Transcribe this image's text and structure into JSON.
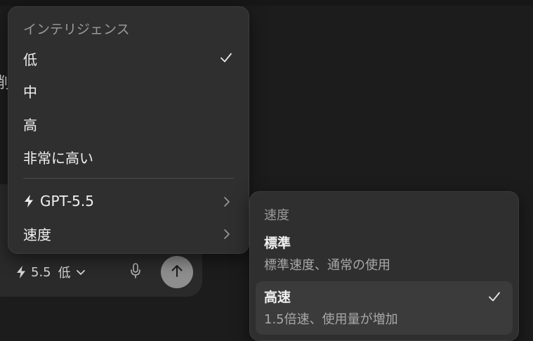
{
  "background": {
    "partial_text": "削"
  },
  "composer": {
    "model_short": "5.5",
    "level": "低",
    "icons": {
      "model": "bolt-icon",
      "dropdown": "chevron-down-icon",
      "mic": "microphone-icon",
      "send": "arrow-up-icon"
    },
    "send_button_color": "#8e8e8e"
  },
  "menu": {
    "header": "インテリジェンス",
    "levels": [
      {
        "label": "低",
        "selected": true
      },
      {
        "label": "中",
        "selected": false
      },
      {
        "label": "高",
        "selected": false
      },
      {
        "label": "非常に高い",
        "selected": false
      }
    ],
    "model_item": {
      "label": "GPT-5.5",
      "icon": "bolt-icon"
    },
    "speed_item": {
      "label": "速度"
    }
  },
  "speed_submenu": {
    "header": "速度",
    "options": [
      {
        "title": "標準",
        "description": "標準速度、通常の使用",
        "selected": false
      },
      {
        "title": "高速",
        "description": "1.5倍速、使用量が増加",
        "selected": true
      }
    ]
  },
  "colors": {
    "page_background": "#1c1c1c",
    "menu_background": "#2f2f2f",
    "selected_option_background": "#3b3b3b",
    "muted_text": "#9a9a9a"
  }
}
